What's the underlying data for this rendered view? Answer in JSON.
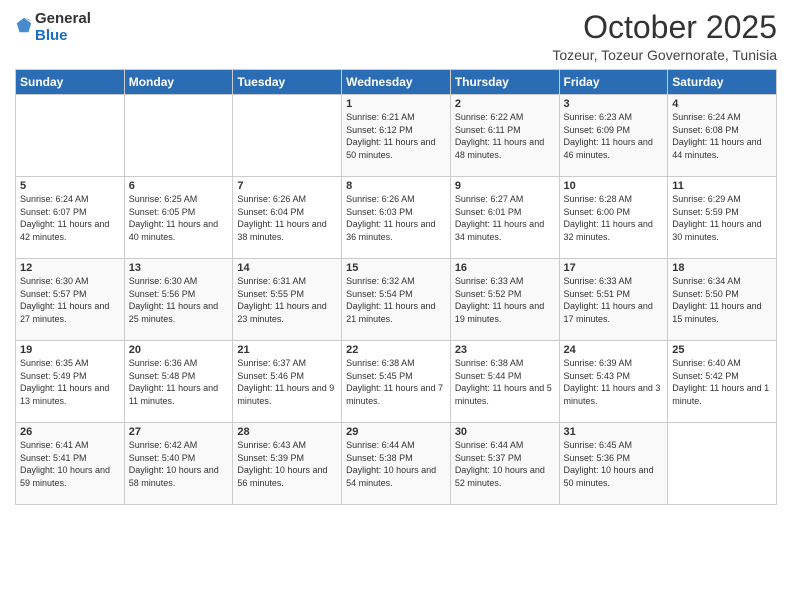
{
  "header": {
    "logo_general": "General",
    "logo_blue": "Blue",
    "month": "October 2025",
    "location": "Tozeur, Tozeur Governorate, Tunisia"
  },
  "weekdays": [
    "Sunday",
    "Monday",
    "Tuesday",
    "Wednesday",
    "Thursday",
    "Friday",
    "Saturday"
  ],
  "weeks": [
    [
      {
        "day": "",
        "sunrise": "",
        "sunset": "",
        "daylight": ""
      },
      {
        "day": "",
        "sunrise": "",
        "sunset": "",
        "daylight": ""
      },
      {
        "day": "",
        "sunrise": "",
        "sunset": "",
        "daylight": ""
      },
      {
        "day": "1",
        "sunrise": "Sunrise: 6:21 AM",
        "sunset": "Sunset: 6:12 PM",
        "daylight": "Daylight: 11 hours and 50 minutes."
      },
      {
        "day": "2",
        "sunrise": "Sunrise: 6:22 AM",
        "sunset": "Sunset: 6:11 PM",
        "daylight": "Daylight: 11 hours and 48 minutes."
      },
      {
        "day": "3",
        "sunrise": "Sunrise: 6:23 AM",
        "sunset": "Sunset: 6:09 PM",
        "daylight": "Daylight: 11 hours and 46 minutes."
      },
      {
        "day": "4",
        "sunrise": "Sunrise: 6:24 AM",
        "sunset": "Sunset: 6:08 PM",
        "daylight": "Daylight: 11 hours and 44 minutes."
      }
    ],
    [
      {
        "day": "5",
        "sunrise": "Sunrise: 6:24 AM",
        "sunset": "Sunset: 6:07 PM",
        "daylight": "Daylight: 11 hours and 42 minutes."
      },
      {
        "day": "6",
        "sunrise": "Sunrise: 6:25 AM",
        "sunset": "Sunset: 6:05 PM",
        "daylight": "Daylight: 11 hours and 40 minutes."
      },
      {
        "day": "7",
        "sunrise": "Sunrise: 6:26 AM",
        "sunset": "Sunset: 6:04 PM",
        "daylight": "Daylight: 11 hours and 38 minutes."
      },
      {
        "day": "8",
        "sunrise": "Sunrise: 6:26 AM",
        "sunset": "Sunset: 6:03 PM",
        "daylight": "Daylight: 11 hours and 36 minutes."
      },
      {
        "day": "9",
        "sunrise": "Sunrise: 6:27 AM",
        "sunset": "Sunset: 6:01 PM",
        "daylight": "Daylight: 11 hours and 34 minutes."
      },
      {
        "day": "10",
        "sunrise": "Sunrise: 6:28 AM",
        "sunset": "Sunset: 6:00 PM",
        "daylight": "Daylight: 11 hours and 32 minutes."
      },
      {
        "day": "11",
        "sunrise": "Sunrise: 6:29 AM",
        "sunset": "Sunset: 5:59 PM",
        "daylight": "Daylight: 11 hours and 30 minutes."
      }
    ],
    [
      {
        "day": "12",
        "sunrise": "Sunrise: 6:30 AM",
        "sunset": "Sunset: 5:57 PM",
        "daylight": "Daylight: 11 hours and 27 minutes."
      },
      {
        "day": "13",
        "sunrise": "Sunrise: 6:30 AM",
        "sunset": "Sunset: 5:56 PM",
        "daylight": "Daylight: 11 hours and 25 minutes."
      },
      {
        "day": "14",
        "sunrise": "Sunrise: 6:31 AM",
        "sunset": "Sunset: 5:55 PM",
        "daylight": "Daylight: 11 hours and 23 minutes."
      },
      {
        "day": "15",
        "sunrise": "Sunrise: 6:32 AM",
        "sunset": "Sunset: 5:54 PM",
        "daylight": "Daylight: 11 hours and 21 minutes."
      },
      {
        "day": "16",
        "sunrise": "Sunrise: 6:33 AM",
        "sunset": "Sunset: 5:52 PM",
        "daylight": "Daylight: 11 hours and 19 minutes."
      },
      {
        "day": "17",
        "sunrise": "Sunrise: 6:33 AM",
        "sunset": "Sunset: 5:51 PM",
        "daylight": "Daylight: 11 hours and 17 minutes."
      },
      {
        "day": "18",
        "sunrise": "Sunrise: 6:34 AM",
        "sunset": "Sunset: 5:50 PM",
        "daylight": "Daylight: 11 hours and 15 minutes."
      }
    ],
    [
      {
        "day": "19",
        "sunrise": "Sunrise: 6:35 AM",
        "sunset": "Sunset: 5:49 PM",
        "daylight": "Daylight: 11 hours and 13 minutes."
      },
      {
        "day": "20",
        "sunrise": "Sunrise: 6:36 AM",
        "sunset": "Sunset: 5:48 PM",
        "daylight": "Daylight: 11 hours and 11 minutes."
      },
      {
        "day": "21",
        "sunrise": "Sunrise: 6:37 AM",
        "sunset": "Sunset: 5:46 PM",
        "daylight": "Daylight: 11 hours and 9 minutes."
      },
      {
        "day": "22",
        "sunrise": "Sunrise: 6:38 AM",
        "sunset": "Sunset: 5:45 PM",
        "daylight": "Daylight: 11 hours and 7 minutes."
      },
      {
        "day": "23",
        "sunrise": "Sunrise: 6:38 AM",
        "sunset": "Sunset: 5:44 PM",
        "daylight": "Daylight: 11 hours and 5 minutes."
      },
      {
        "day": "24",
        "sunrise": "Sunrise: 6:39 AM",
        "sunset": "Sunset: 5:43 PM",
        "daylight": "Daylight: 11 hours and 3 minutes."
      },
      {
        "day": "25",
        "sunrise": "Sunrise: 6:40 AM",
        "sunset": "Sunset: 5:42 PM",
        "daylight": "Daylight: 11 hours and 1 minute."
      }
    ],
    [
      {
        "day": "26",
        "sunrise": "Sunrise: 6:41 AM",
        "sunset": "Sunset: 5:41 PM",
        "daylight": "Daylight: 10 hours and 59 minutes."
      },
      {
        "day": "27",
        "sunrise": "Sunrise: 6:42 AM",
        "sunset": "Sunset: 5:40 PM",
        "daylight": "Daylight: 10 hours and 58 minutes."
      },
      {
        "day": "28",
        "sunrise": "Sunrise: 6:43 AM",
        "sunset": "Sunset: 5:39 PM",
        "daylight": "Daylight: 10 hours and 56 minutes."
      },
      {
        "day": "29",
        "sunrise": "Sunrise: 6:44 AM",
        "sunset": "Sunset: 5:38 PM",
        "daylight": "Daylight: 10 hours and 54 minutes."
      },
      {
        "day": "30",
        "sunrise": "Sunrise: 6:44 AM",
        "sunset": "Sunset: 5:37 PM",
        "daylight": "Daylight: 10 hours and 52 minutes."
      },
      {
        "day": "31",
        "sunrise": "Sunrise: 6:45 AM",
        "sunset": "Sunset: 5:36 PM",
        "daylight": "Daylight: 10 hours and 50 minutes."
      },
      {
        "day": "",
        "sunrise": "",
        "sunset": "",
        "daylight": ""
      }
    ]
  ]
}
